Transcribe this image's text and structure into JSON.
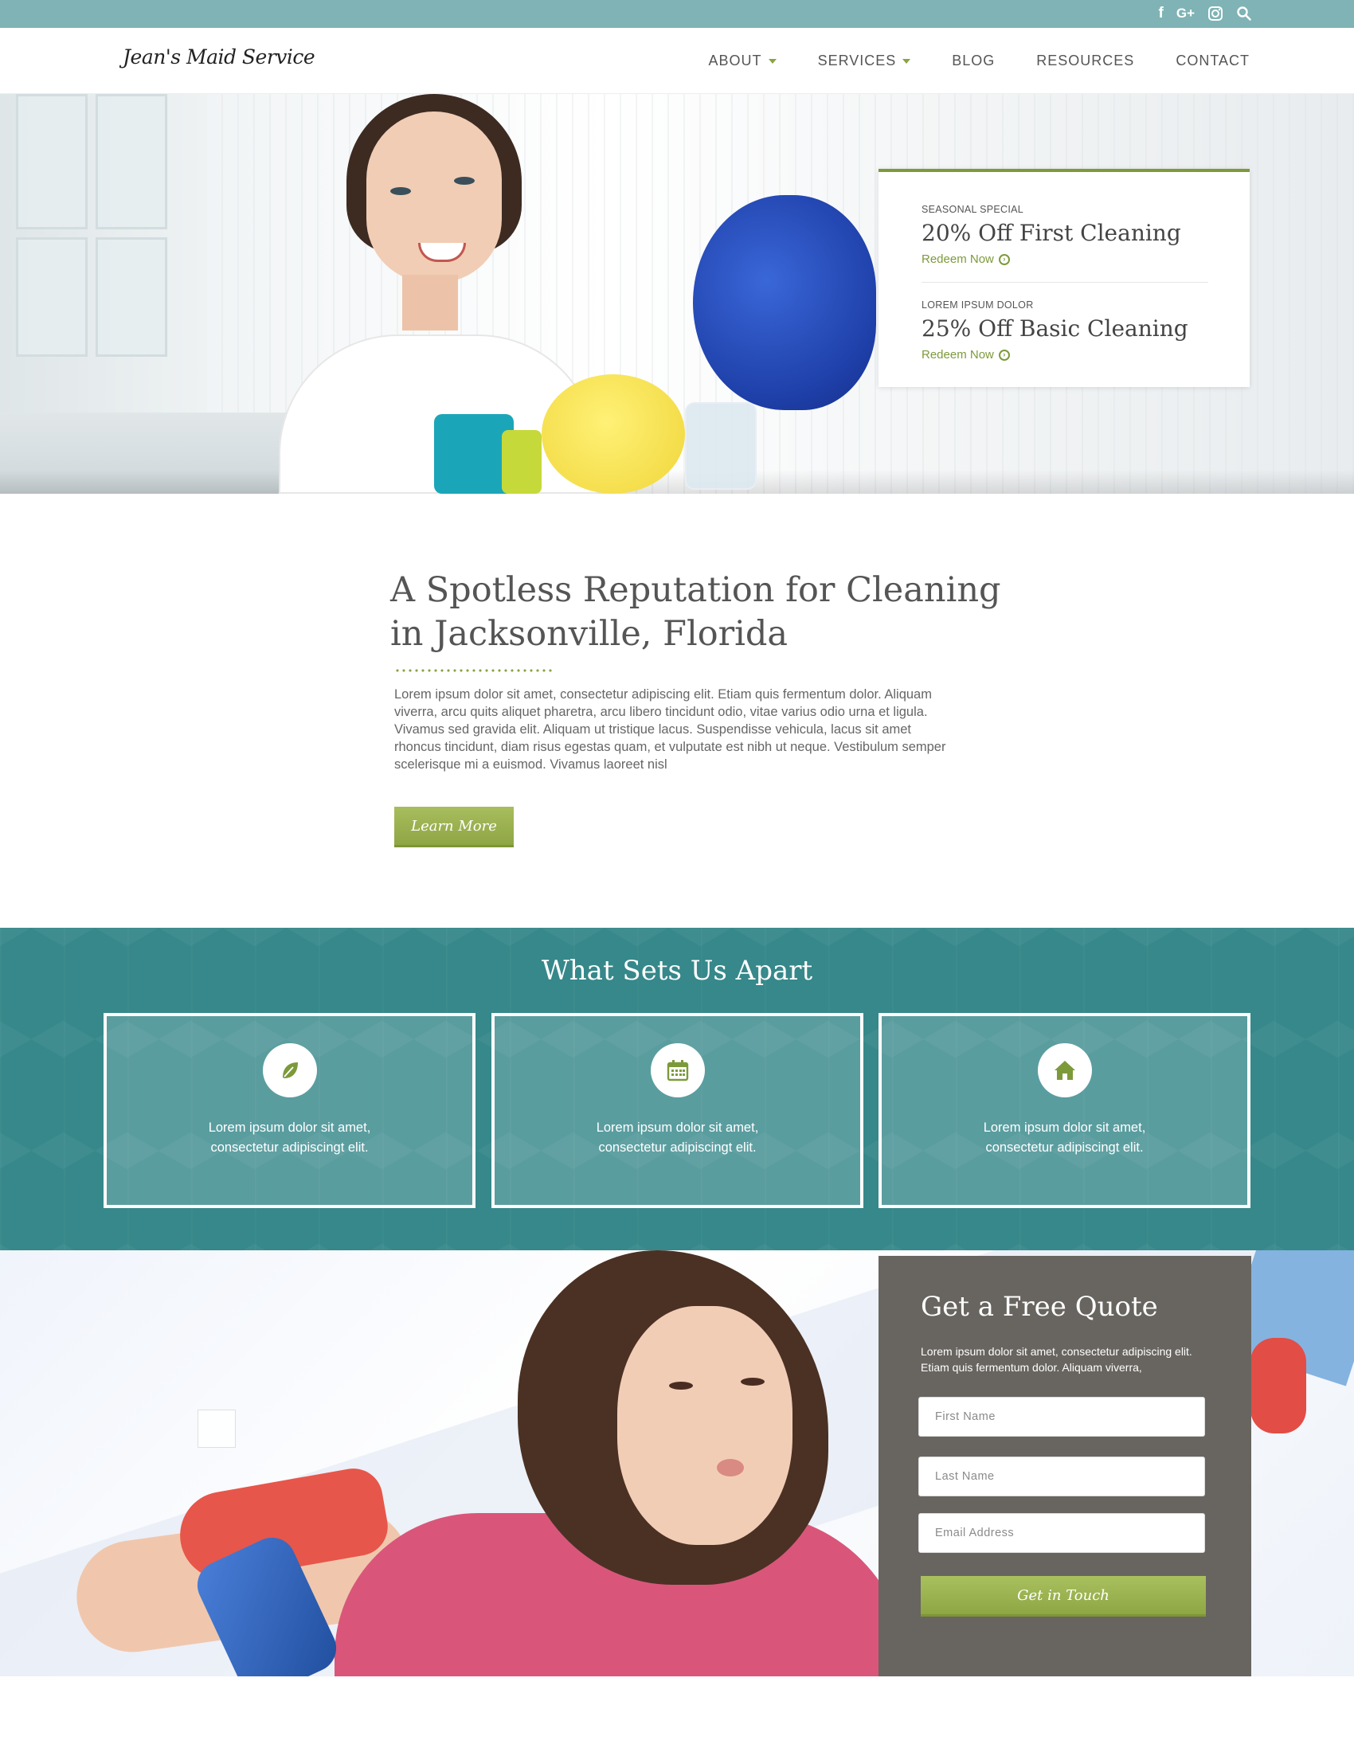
{
  "header": {
    "logo": "Jean's Maid Service",
    "nav": [
      {
        "label": "ABOUT",
        "has_dropdown": true
      },
      {
        "label": "SERVICES",
        "has_dropdown": true
      },
      {
        "label": "BLOG",
        "has_dropdown": false
      },
      {
        "label": "RESOURCES",
        "has_dropdown": false
      },
      {
        "label": "CONTACT",
        "has_dropdown": false
      }
    ]
  },
  "topbar": {
    "icons": [
      "facebook-icon",
      "google-plus-icon",
      "instagram-icon",
      "search-icon"
    ],
    "color": "#7fb3b5"
  },
  "hero": {
    "promos": [
      {
        "kicker": "SEASONAL SPECIAL",
        "title": "20% Off First Cleaning",
        "link": "Redeem Now"
      },
      {
        "kicker": "LOREM IPSUM DOLOR",
        "title": "25% Off Basic Cleaning",
        "link": "Redeem Now"
      }
    ]
  },
  "intro": {
    "title_line1": "A Spotless Reputation for Cleaning",
    "title_line2": "in Jacksonville, Florida",
    "body": "Lorem ipsum dolor sit amet, consectetur adipiscing elit. Etiam quis fermentum dolor. Aliquam viverra, arcu quits aliquet pharetra, arcu libero tincidunt odio, vitae varius odio urna et ligula. Vivamus sed gravida elit. Aliquam ut tristique lacus. Suspendisse vehicula, lacus sit amet rhoncus tincidunt, diam risus egestas quam, et vulputate est nibh ut neque. Vestibulum semper scelerisque mi a euismod. Vivamus laoreet nisl",
    "button": "Learn More"
  },
  "features": {
    "heading": "What Sets Us Apart",
    "items": [
      {
        "icon": "leaf-icon",
        "line1": "Lorem ipsum dolor sit amet,",
        "line2": "consectetur adipiscingt elit."
      },
      {
        "icon": "calendar-icon",
        "line1": "Lorem ipsum dolor sit amet,",
        "line2": "consectetur adipiscingt elit."
      },
      {
        "icon": "home-icon",
        "line1": "Lorem ipsum dolor sit amet,",
        "line2": "consectetur adipiscingt elit."
      }
    ],
    "color": "#36888a"
  },
  "quote": {
    "title": "Get a Free Quote",
    "desc": "Lorem ipsum dolor sit amet, consectetur adipiscing elit. Etiam quis fermentum dolor. Aliquam viverra,",
    "first_name_placeholder": "First Name",
    "last_name_placeholder": "Last Name",
    "email_placeholder": "Email Address",
    "button": "Get in Touch"
  },
  "colors": {
    "accent_green": "#8aa343",
    "quote_panel": "#686560"
  }
}
